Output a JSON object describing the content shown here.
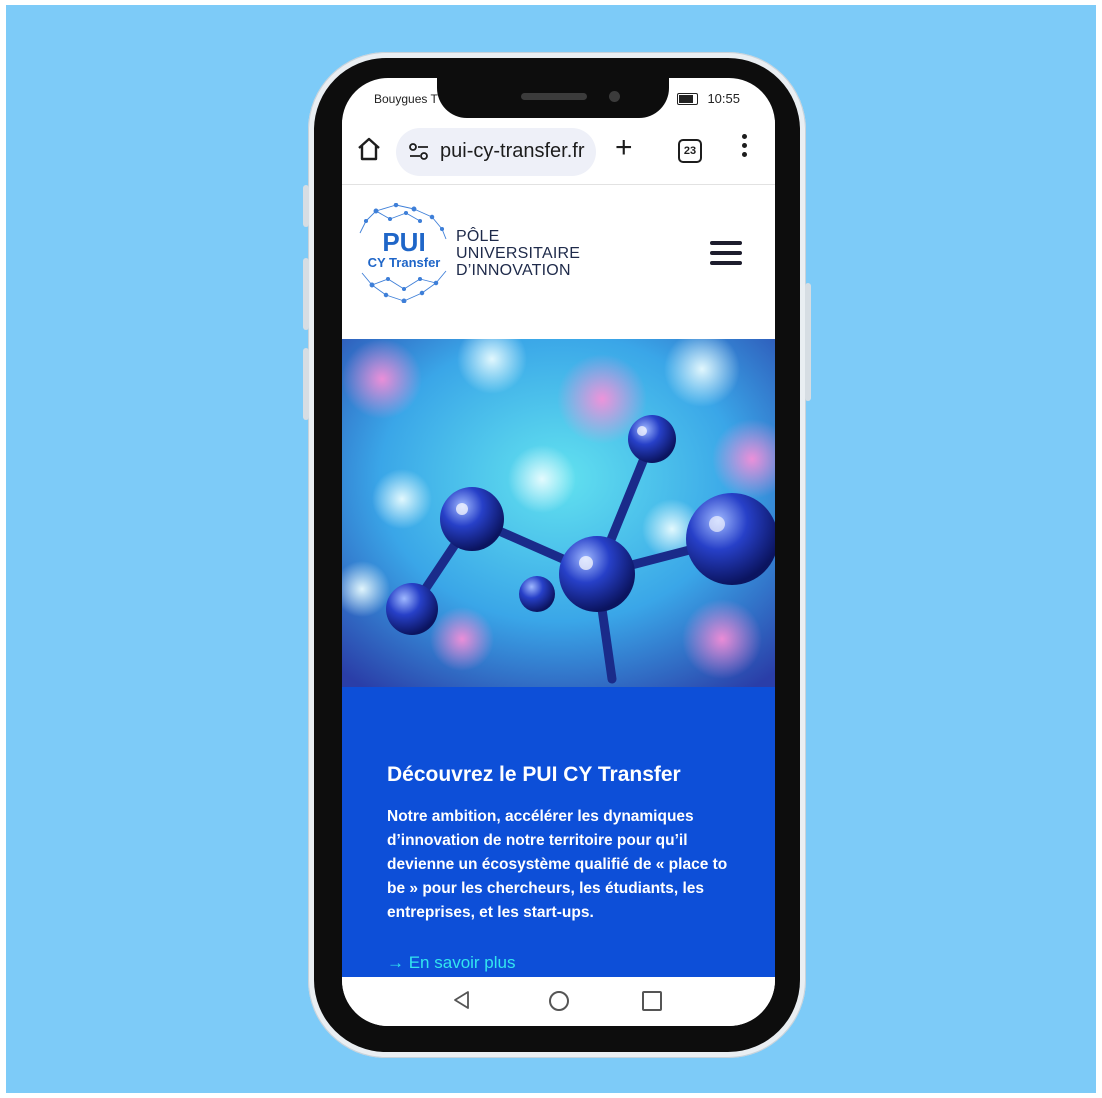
{
  "status_bar": {
    "carrier": "Bouygues T",
    "time": "10:55"
  },
  "browser": {
    "url": "pui-cy-transfer.fr",
    "tab_count": "23",
    "icons": [
      "home-icon",
      "site-settings-icon",
      "new-tab-plus-icon",
      "tabs-icon",
      "more-vert-icon"
    ]
  },
  "site": {
    "logo": {
      "mark_line1": "PUI",
      "mark_line2": "CY Transfer"
    },
    "tagline_lines": [
      "PÔLE",
      "UNIVERSITAIRE",
      "D’INNOVATION"
    ],
    "menu_icon": "hamburger-menu-icon"
  },
  "promo": {
    "heading": "Découvrez le PUI CY Transfer",
    "body": "Notre ambition, accélérer les dynamiques d’innovation de notre territoire pour qu’il devienne un écosystème qualifié de « place to be » pour les chercheurs, les étudiants, les entreprises, et les start-ups.",
    "link": "→ En savoir plus"
  },
  "colors": {
    "background": "#7dcbf8",
    "promo_blue": "#0d4fd8",
    "link_cyan": "#33e6ef",
    "logo_blue": "#1f66c8"
  }
}
